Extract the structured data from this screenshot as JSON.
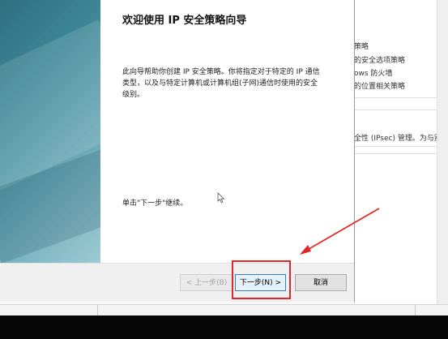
{
  "wizard": {
    "title": "欢迎使用 IP 安全策略向导",
    "description": "此向导帮助你创建 IP 安全策略。你将指定对于特定的 IP 通信类型，以及与特定计算机或计算机组(子网)通信时使用的安全级别。",
    "hint": "单击\"下一步\"继续。",
    "buttons": {
      "back": "< 上一步(B)",
      "next": "下一步(N) >",
      "cancel": "取消"
    }
  },
  "background_window": {
    "lines": [
      "策略",
      "的安全选项策略",
      "ows 防火墙",
      "的位置相关策略",
      "全性 (IPsec) 管理。为与别的…"
    ]
  },
  "annotation": {
    "color": "#e0282a",
    "target": "next-button"
  }
}
